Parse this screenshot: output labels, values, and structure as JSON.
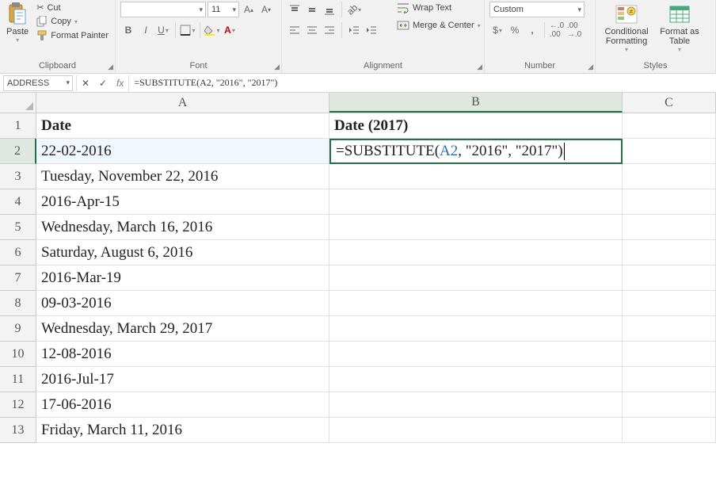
{
  "ribbon": {
    "clipboard": {
      "paste": "Paste",
      "cut": "Cut",
      "copy": "Copy",
      "format_painter": "Format Painter",
      "label": "Clipboard"
    },
    "font": {
      "font_name": "",
      "font_size": "11",
      "bold": "B",
      "italic": "I",
      "underline": "U",
      "label": "Font"
    },
    "alignment": {
      "wrap": "Wrap Text",
      "merge": "Merge & Center",
      "label": "Alignment"
    },
    "number": {
      "format": "Custom",
      "currency": "$",
      "percent": "%",
      "comma": ",",
      "inc_dec": "⁰₀",
      "dec_dec": "₀⁰",
      "label": "Number"
    },
    "styles": {
      "cond": "Conditional Formatting",
      "table": "Format as Table",
      "label": "Styles"
    }
  },
  "formula_bar": {
    "name_box": "ADDRESS",
    "cancel": "✕",
    "enter": "✓",
    "fx": "fx",
    "formula_prefix": "=SUBSTITUTE(A2, \"2016\", \"2017\")"
  },
  "columns": [
    "A",
    "B",
    "C"
  ],
  "headers": {
    "A": "Date",
    "B": "Date (2017)"
  },
  "rows": [
    {
      "n": 1,
      "A": "Date",
      "B": "Date (2017)",
      "header": true
    },
    {
      "n": 2,
      "A": "22-02-2016",
      "B_formula": {
        "p1": "=SUBSTITUTE(",
        "ref": "A2",
        "p2": ", \"2016\", \"2017\")"
      },
      "active": true
    },
    {
      "n": 3,
      "A": "Tuesday, November 22, 2016"
    },
    {
      "n": 4,
      "A": "2016-Apr-15"
    },
    {
      "n": 5,
      "A": "Wednesday, March 16, 2016"
    },
    {
      "n": 6,
      "A": "Saturday, August 6, 2016"
    },
    {
      "n": 7,
      "A": "2016-Mar-19"
    },
    {
      "n": 8,
      "A": "09-03-2016"
    },
    {
      "n": 9,
      "A": "Wednesday, March 29, 2017"
    },
    {
      "n": 10,
      "A": "12-08-2016"
    },
    {
      "n": 11,
      "A": "2016-Jul-17"
    },
    {
      "n": 12,
      "A": "17-06-2016"
    },
    {
      "n": 13,
      "A": "Friday, March 11, 2016"
    }
  ],
  "active_cell": "B2"
}
